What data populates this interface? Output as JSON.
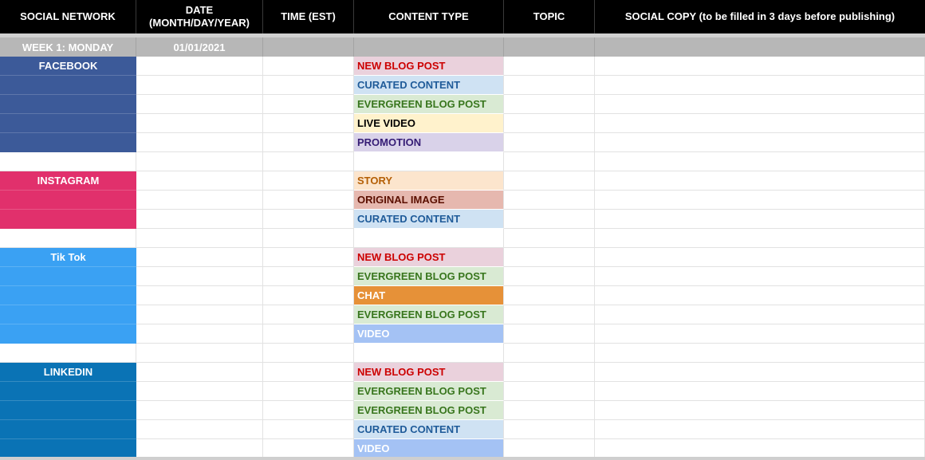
{
  "headers": [
    {
      "label": "SOCIAL NETWORK"
    },
    {
      "label": "DATE\n(MONTH/DAY/YEAR)"
    },
    {
      "label": "TIME (EST)"
    },
    {
      "label": "CONTENT TYPE"
    },
    {
      "label": "TOPIC"
    },
    {
      "label": "SOCIAL COPY (to be filled in 3 days before publishing)"
    }
  ],
  "week": {
    "label": "WEEK 1: MONDAY",
    "date": "01/01/2021"
  },
  "networks": [
    {
      "name": "FACEBOOK",
      "color": "#3c5a99",
      "items": [
        {
          "label": "NEW BLOG POST",
          "bg": "#ead1dc",
          "fg": "#cc0000"
        },
        {
          "label": "CURATED CONTENT",
          "bg": "#cfe2f3",
          "fg": "#1f5b99"
        },
        {
          "label": "EVERGREEN BLOG POST",
          "bg": "#d9ead3",
          "fg": "#38761d"
        },
        {
          "label": "LIVE VIDEO",
          "bg": "#fff2cc",
          "fg": "#000000"
        },
        {
          "label": "PROMOTION",
          "bg": "#d9d2e9",
          "fg": "#351c75"
        }
      ]
    },
    {
      "name": "INSTAGRAM",
      "color": "#e1306c",
      "items": [
        {
          "label": "STORY",
          "bg": "#fce5cd",
          "fg": "#b45f06"
        },
        {
          "label": "ORIGINAL IMAGE",
          "bg": "#e6b8af",
          "fg": "#5b0f00"
        },
        {
          "label": "CURATED CONTENT",
          "bg": "#cfe2f3",
          "fg": "#1f5b99"
        }
      ]
    },
    {
      "name": "Tik Tok",
      "color": "#3aa1f3",
      "items": [
        {
          "label": "NEW BLOG POST",
          "bg": "#ead1dc",
          "fg": "#cc0000"
        },
        {
          "label": "EVERGREEN BLOG POST",
          "bg": "#d9ead3",
          "fg": "#38761d"
        },
        {
          "label": "CHAT",
          "bg": "#e69138",
          "fg": "#ffffff"
        },
        {
          "label": "EVERGREEN BLOG POST",
          "bg": "#d9ead3",
          "fg": "#38761d"
        },
        {
          "label": "VIDEO",
          "bg": "#a4c2f4",
          "fg": "#ffffff"
        }
      ]
    },
    {
      "name": "LINKEDIN",
      "color": "#0a73b5",
      "items": [
        {
          "label": "NEW BLOG POST",
          "bg": "#ead1dc",
          "fg": "#cc0000"
        },
        {
          "label": "EVERGREEN BLOG POST",
          "bg": "#d9ead3",
          "fg": "#38761d"
        },
        {
          "label": "EVERGREEN BLOG POST",
          "bg": "#d9ead3",
          "fg": "#38761d"
        },
        {
          "label": "CURATED CONTENT",
          "bg": "#cfe2f3",
          "fg": "#1f5b99"
        },
        {
          "label": "VIDEO",
          "bg": "#a4c2f4",
          "fg": "#ffffff"
        }
      ]
    }
  ]
}
